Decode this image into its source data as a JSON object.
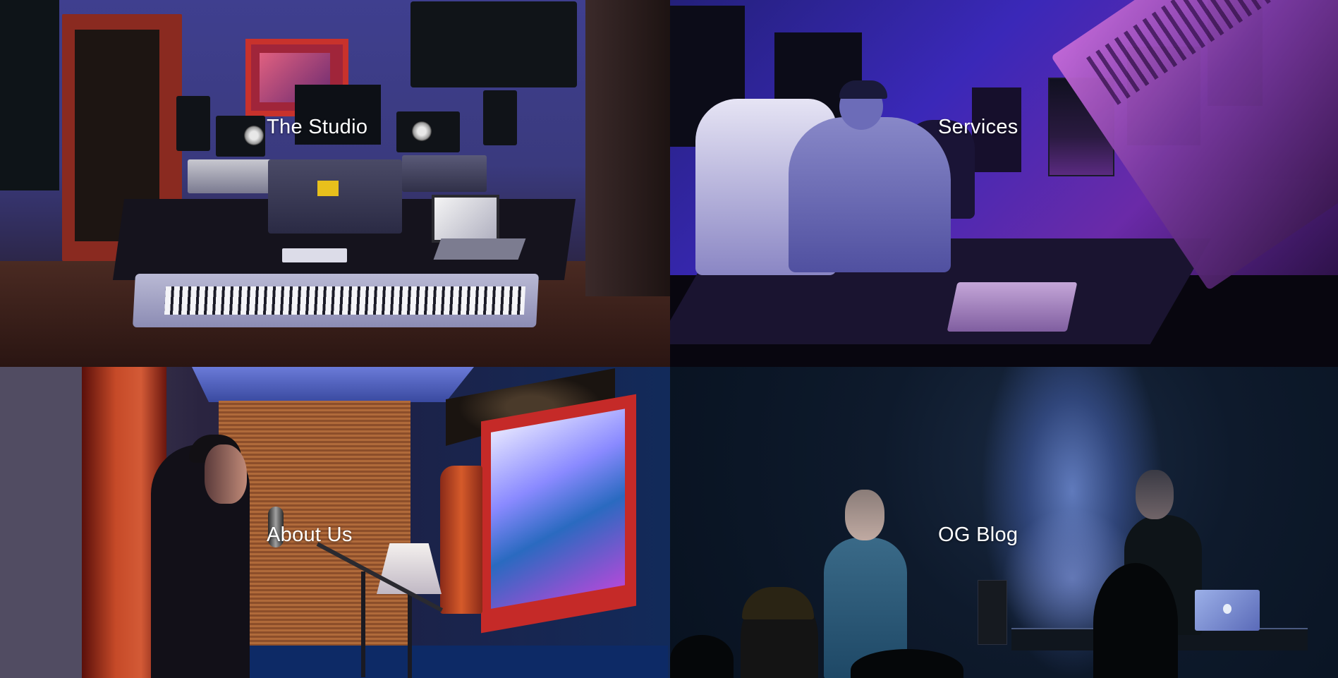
{
  "tiles": [
    {
      "label": "The Studio"
    },
    {
      "label": "Services"
    },
    {
      "label": "About Us"
    },
    {
      "label": "OG Blog"
    }
  ]
}
